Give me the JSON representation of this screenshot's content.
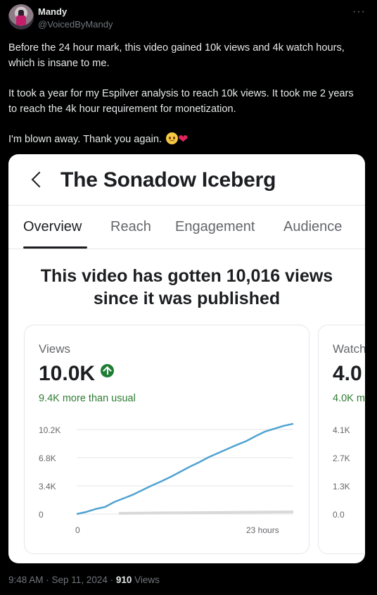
{
  "tweet": {
    "author_name": "Mandy",
    "author_handle": "@VoicedByMandy",
    "paragraphs": [
      "Before the 24 hour mark, this video gained 10k views and 4k watch hours, which is insane to me.",
      "It took a year for my Espilver analysis to reach 10k views. It took me 2 years to reach the 4k hour requirement for monetization.",
      "I'm blown away. Thank you again."
    ],
    "more_icon": "ellipsis-icon",
    "timestamp": "9:48 AM · Sep 11, 2024 ·",
    "view_count": "910",
    "views_label": "Views"
  },
  "card": {
    "title": "The Sonadow Iceberg",
    "back_icon": "chevron-left-icon",
    "tabs": [
      {
        "label": "Overview",
        "active": true
      },
      {
        "label": "Reach",
        "active": false
      },
      {
        "label": "Engagement",
        "active": false
      },
      {
        "label": "Audience",
        "active": false
      }
    ],
    "headline_line1": "This video has gotten 10,016 views",
    "headline_line2": "since it was published",
    "metrics": [
      {
        "label": "Views",
        "value": "10.0K",
        "trend_icon": "arrow-up-circle-icon",
        "sub": "9.4K more than usual",
        "y_ticks": [
          "10.2K",
          "6.8K",
          "3.4K",
          "0"
        ],
        "x_ticks": [
          "0",
          "23 hours"
        ]
      },
      {
        "label": "Watch",
        "value": "4.0",
        "sub": "4.0K m",
        "y_ticks": [
          "4.1K",
          "2.7K",
          "1.3K",
          "0.0"
        ]
      }
    ]
  },
  "colors": {
    "line": "#4fa3d1",
    "baseline": "#d9d9d9",
    "positive": "#1e7d34"
  },
  "chart_data": {
    "type": "line",
    "x": [
      0,
      1,
      2,
      3,
      4,
      5,
      6,
      7,
      8,
      9,
      10,
      11,
      12,
      13,
      14,
      15,
      16,
      17,
      18,
      19,
      20,
      21,
      22,
      23
    ],
    "series": [
      {
        "values": [
          0,
          250,
          600,
          850,
          1450,
          1900,
          2350,
          2900,
          3450,
          3950,
          4500,
          5100,
          5700,
          6250,
          6850,
          7350,
          7850,
          8350,
          8800,
          9400,
          9950,
          10300,
          10650,
          10900
        ]
      }
    ],
    "ylim": [
      0,
      10200
    ],
    "y_ticks": [
      0,
      3400,
      6800,
      10200
    ],
    "x_tick_labels": [
      "0",
      "23 hours"
    ],
    "grid": true
  }
}
